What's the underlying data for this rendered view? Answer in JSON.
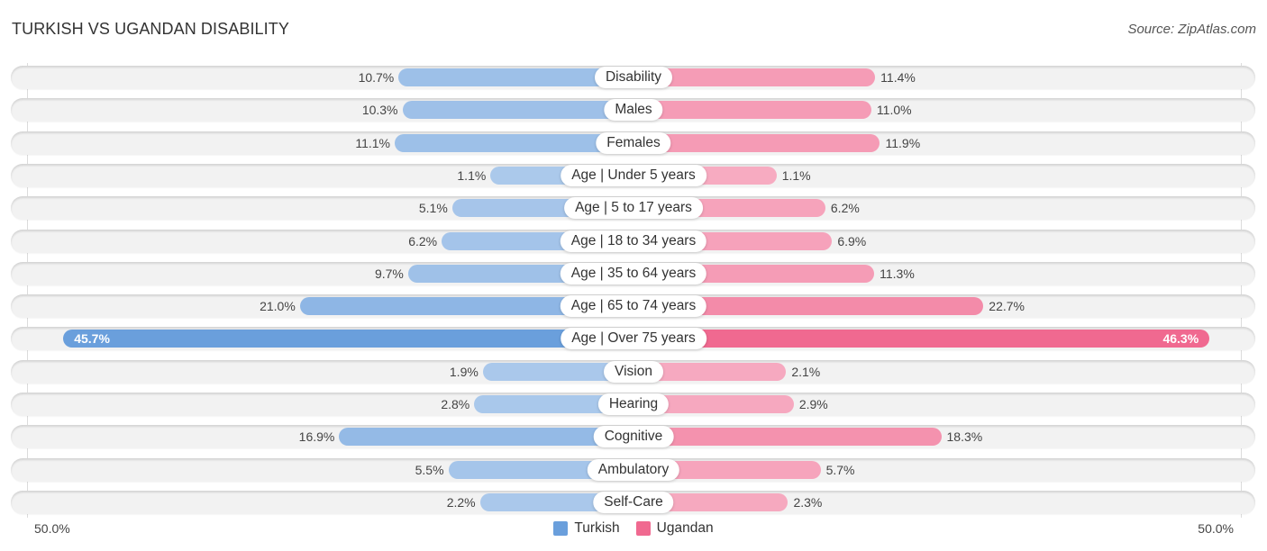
{
  "header": {
    "title": "TURKISH VS UGANDAN DISABILITY",
    "source": "Source: ZipAtlas.com"
  },
  "legend": {
    "items": [
      {
        "label": "Turkish",
        "color": "#6a9fdc"
      },
      {
        "label": "Ugandan",
        "color": "#f06990"
      }
    ]
  },
  "axis": {
    "left_label": "50.0%",
    "right_label": "50.0%"
  },
  "chart_data": {
    "type": "bar",
    "orientation": "diverging-horizontal",
    "title": "TURKISH VS UGANDAN DISABILITY",
    "xlabel": "",
    "ylabel": "",
    "xlim": [
      -50,
      50
    ],
    "unit": "%",
    "legend_position": "bottom-center",
    "categories": [
      "Disability",
      "Males",
      "Females",
      "Age | Under 5 years",
      "Age | 5 to 17 years",
      "Age | 18 to 34 years",
      "Age | 35 to 64 years",
      "Age | 65 to 74 years",
      "Age | Over 75 years",
      "Vision",
      "Hearing",
      "Cognitive",
      "Ambulatory",
      "Self-Care"
    ],
    "series": [
      {
        "name": "Turkish",
        "color": "#6a9fdc",
        "values": [
          10.7,
          10.3,
          11.1,
          1.1,
          5.1,
          6.2,
          9.7,
          21.0,
          45.7,
          1.9,
          2.8,
          16.9,
          5.5,
          2.2
        ],
        "labels": [
          "10.7%",
          "10.3%",
          "11.1%",
          "1.1%",
          "5.1%",
          "6.2%",
          "9.7%",
          "21.0%",
          "45.7%",
          "1.9%",
          "2.8%",
          "16.9%",
          "5.5%",
          "2.2%"
        ]
      },
      {
        "name": "Ugandan",
        "color": "#f06990",
        "values": [
          11.4,
          11.0,
          11.9,
          1.1,
          6.2,
          6.9,
          11.3,
          22.7,
          46.3,
          2.1,
          2.9,
          18.3,
          5.7,
          2.3
        ],
        "labels": [
          "11.4%",
          "11.0%",
          "11.9%",
          "1.1%",
          "6.2%",
          "6.9%",
          "11.3%",
          "22.7%",
          "46.3%",
          "2.1%",
          "2.9%",
          "18.3%",
          "5.7%",
          "2.3%"
        ]
      }
    ]
  }
}
